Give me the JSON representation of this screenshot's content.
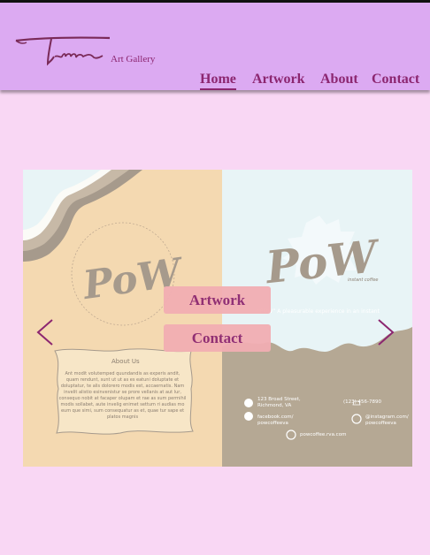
{
  "brand": {
    "logo_text": "Time",
    "subtitle": "Art Gallery"
  },
  "nav": {
    "home": "Home",
    "artwork": "Artwork",
    "about": "About",
    "contact": "Contact"
  },
  "slider": {
    "overlay_buttons": {
      "artwork": "Artwork",
      "contact": "Contact"
    },
    "left_slide": {
      "logo_text": "PoW",
      "ring_text": "“POW” – A pleasurable experience in an instant",
      "about_title": "About Us",
      "about_body": "Ant modit volutemped quundandis as experis andit, quam rendunt, sunt ut ut as es eatuni doluptate et doluptatur, te alis dolorero modis est, accaernatis. Nam invelit alistio esinvenistur se prore vellanis at aut lur, consequo nobit at facaper olupam et rae as sum permihil modis sollabet, aute invelig enimet settum ri audias mo eum que simi, sum consequatur as et, quae tur sape et platos magnis"
    },
    "right_slide": {
      "logo_text": "PoW",
      "logo_sub": "instant coffee",
      "tagline": "“POW” A pleasurable experience in an instant",
      "address": "123 Broad Street, Richmond, VA",
      "phone": "(123) 456-7890",
      "facebook": "facebook.com/ powcoffeeva",
      "instagram": "@instagram.com/ powcoffeeva",
      "website": "powcoffee.rva.com"
    }
  }
}
